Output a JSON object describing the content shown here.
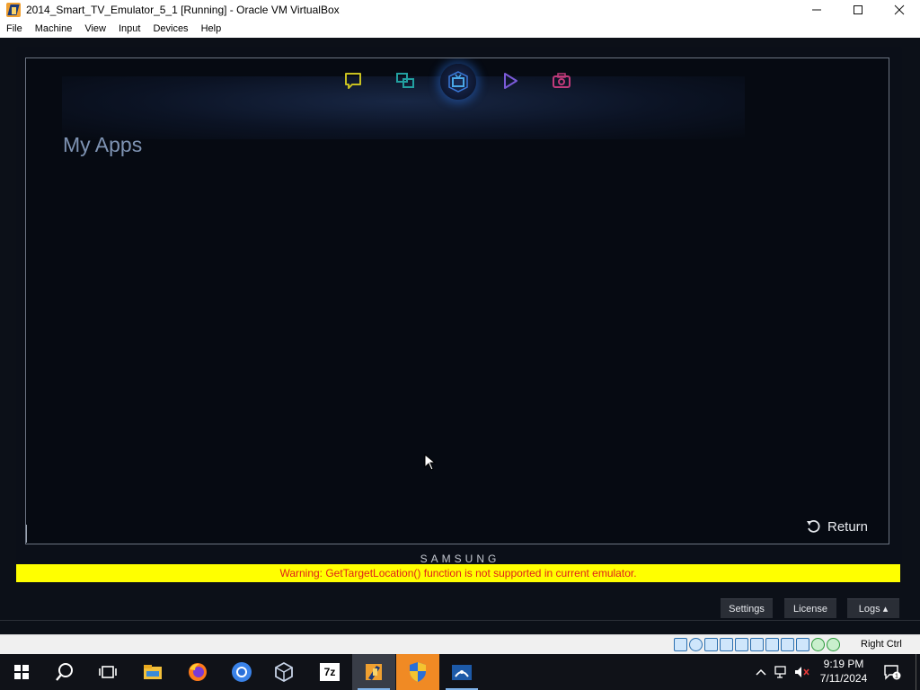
{
  "window": {
    "title": "2014_Smart_TV_Emulator_5_1 [Running] - Oracle VM VirtualBox",
    "controls": {
      "minimize": "—",
      "maximize": "☐",
      "close": "✕"
    }
  },
  "menubar": {
    "items": [
      "File",
      "Machine",
      "View",
      "Input",
      "Devices",
      "Help"
    ]
  },
  "tv": {
    "categories": [
      {
        "name": "chat-icon",
        "color": "#c8c020"
      },
      {
        "name": "multi-screen-icon",
        "color": "#22a0a0"
      },
      {
        "name": "tv-icon",
        "color": "#4aa8e8",
        "selected": true
      },
      {
        "name": "play-icon",
        "color": "#7a5ad8"
      },
      {
        "name": "camera-icon",
        "color": "#c03a7a"
      }
    ],
    "page_title": "My Apps",
    "return_label": "Return"
  },
  "emulator": {
    "brand": "SAMSUNG",
    "warning": "Warning: GetTargetLocation() function is not supported in current emulator.",
    "tabs": {
      "settings": "Settings",
      "license": "License",
      "logs": "Logs ▴"
    }
  },
  "statusbar": {
    "host_key": "Right Ctrl"
  },
  "taskbar": {
    "apps": [
      "start-icon",
      "search-icon",
      "task-view-icon",
      "file-explorer-icon",
      "firefox-icon",
      "chrome-icon",
      "virtualbox-icon",
      "7zip-icon",
      "emulator-icon",
      "shield-icon",
      "sdk-icon"
    ],
    "seven_zip_label": "7z",
    "time": "9:19 PM",
    "date": "7/11/2024",
    "notification_count": "1"
  }
}
